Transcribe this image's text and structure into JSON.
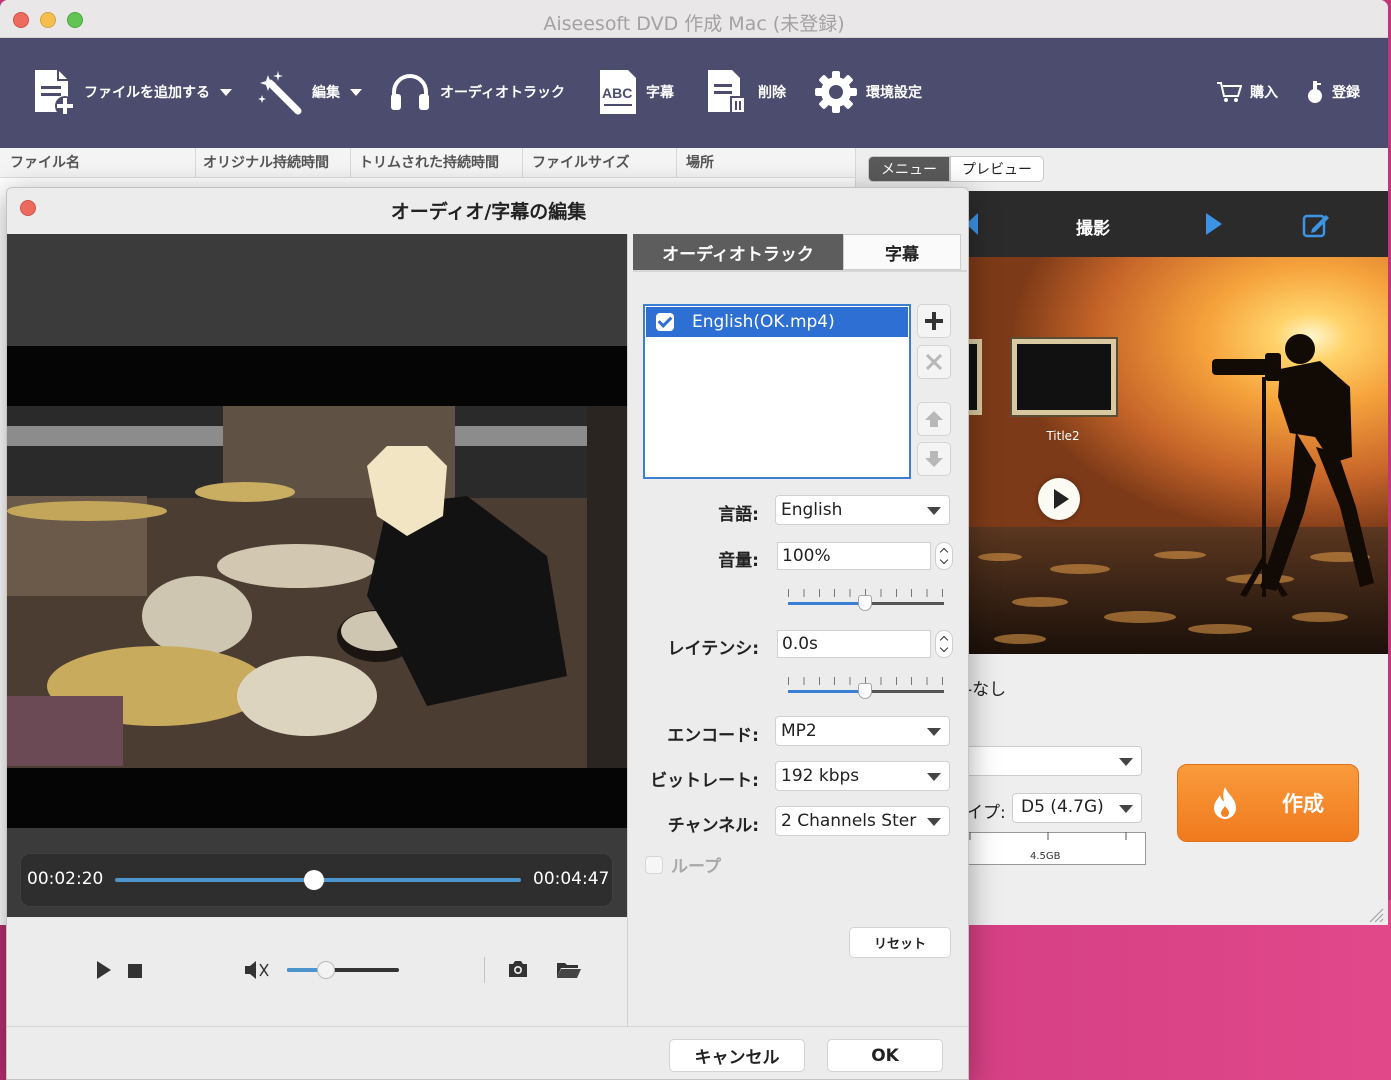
{
  "window": {
    "title": "Aiseesoft DVD 作成 Mac (未登録)"
  },
  "toolbar": {
    "add_file": "ファイルを追加する",
    "edit": "編集",
    "audio_track": "オーディオトラック",
    "subtitle": "字幕",
    "delete": "削除",
    "preferences": "環境設定",
    "buy": "購入",
    "register": "登録"
  },
  "file_list": {
    "columns": [
      "ファイル名",
      "オリジナル持続時間",
      "トリムされた持続時間",
      "ファイルサイズ",
      "場所"
    ]
  },
  "right_panel": {
    "tab_menu": "メニュー",
    "tab_preview": "プレビュー",
    "menu_title": "撮影",
    "thumb_label": "Title2",
    "none_label": "-なし",
    "type_label": "イプ:",
    "disc_type": "D5 (4.7G)",
    "capacity_label": "4.5GB",
    "create_button": "作成"
  },
  "dialog": {
    "title": "オーディオ/字幕の編集",
    "current_time": "00:02:20",
    "total_time": "00:04:47",
    "playback_progress": 0.49,
    "playback_volume": 0.35,
    "tabs": {
      "audio": "オーディオトラック",
      "subtitle": "字幕"
    },
    "tracks": [
      {
        "name": "English(OK.mp4)",
        "checked": true
      }
    ],
    "language": {
      "label": "言語:",
      "value": "English"
    },
    "volume": {
      "label": "音量:",
      "value": "100%",
      "slider": 0.5
    },
    "latency": {
      "label": "レイテンシ:",
      "value": "0.0s",
      "slider": 0.5
    },
    "encoder": {
      "label": "エンコード:",
      "value": "MP2"
    },
    "bitrate": {
      "label": "ビットレート:",
      "value": "192 kbps"
    },
    "channel": {
      "label": "チャンネル:",
      "value": "2 Channels Ster"
    },
    "loop": {
      "label": "ループ",
      "checked": false
    },
    "reset_button": "リセット",
    "cancel_button": "キャンセル",
    "ok_button": "OK"
  },
  "colors": {
    "toolbar": "#4c4d6e",
    "accent": "#2e6fd3",
    "create": "#f5872a",
    "seek": "#4b94cc"
  }
}
